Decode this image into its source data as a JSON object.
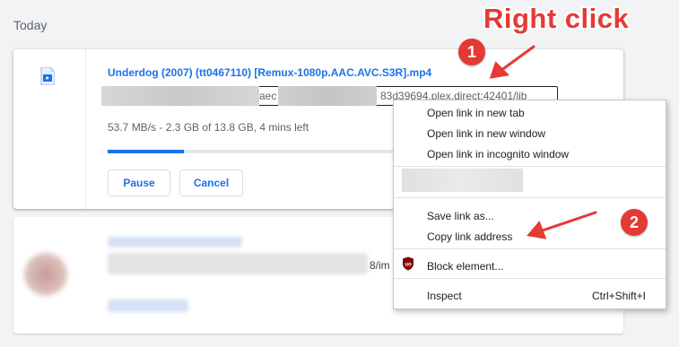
{
  "section": {
    "title": "Today"
  },
  "download": {
    "file_name": "Underdog (2007) (tt0467110) [Remux-1080p.AAC.AVC.S3R].mp4",
    "url_fragment_1": "aec",
    "url_fragment_2": "83d39694.plex.direct:42401/lib",
    "status": "53.7 MB/s - 2.3 GB of 13.8 GB, 4 mins left",
    "progress_fraction": 0.167,
    "pause_label": "Pause",
    "cancel_label": "Cancel",
    "icon": "video-file-icon"
  },
  "second_item": {
    "fragment": "8/im"
  },
  "context_menu": {
    "items": [
      {
        "label": "Open link in new tab"
      },
      {
        "label": "Open link in new window"
      },
      {
        "label": "Open link in incognito window"
      },
      {
        "label": "Save link as..."
      },
      {
        "label": "Copy link address"
      },
      {
        "label": "Block element...",
        "icon": "ublock-icon"
      },
      {
        "label": "Inspect",
        "shortcut": "Ctrl+Shift+I"
      }
    ]
  },
  "annotations": {
    "title": "Right click",
    "step1": "1",
    "step2": "2",
    "color": "#e53935"
  },
  "colors": {
    "accent": "#1a73e8",
    "background": "#f1f3f4"
  }
}
